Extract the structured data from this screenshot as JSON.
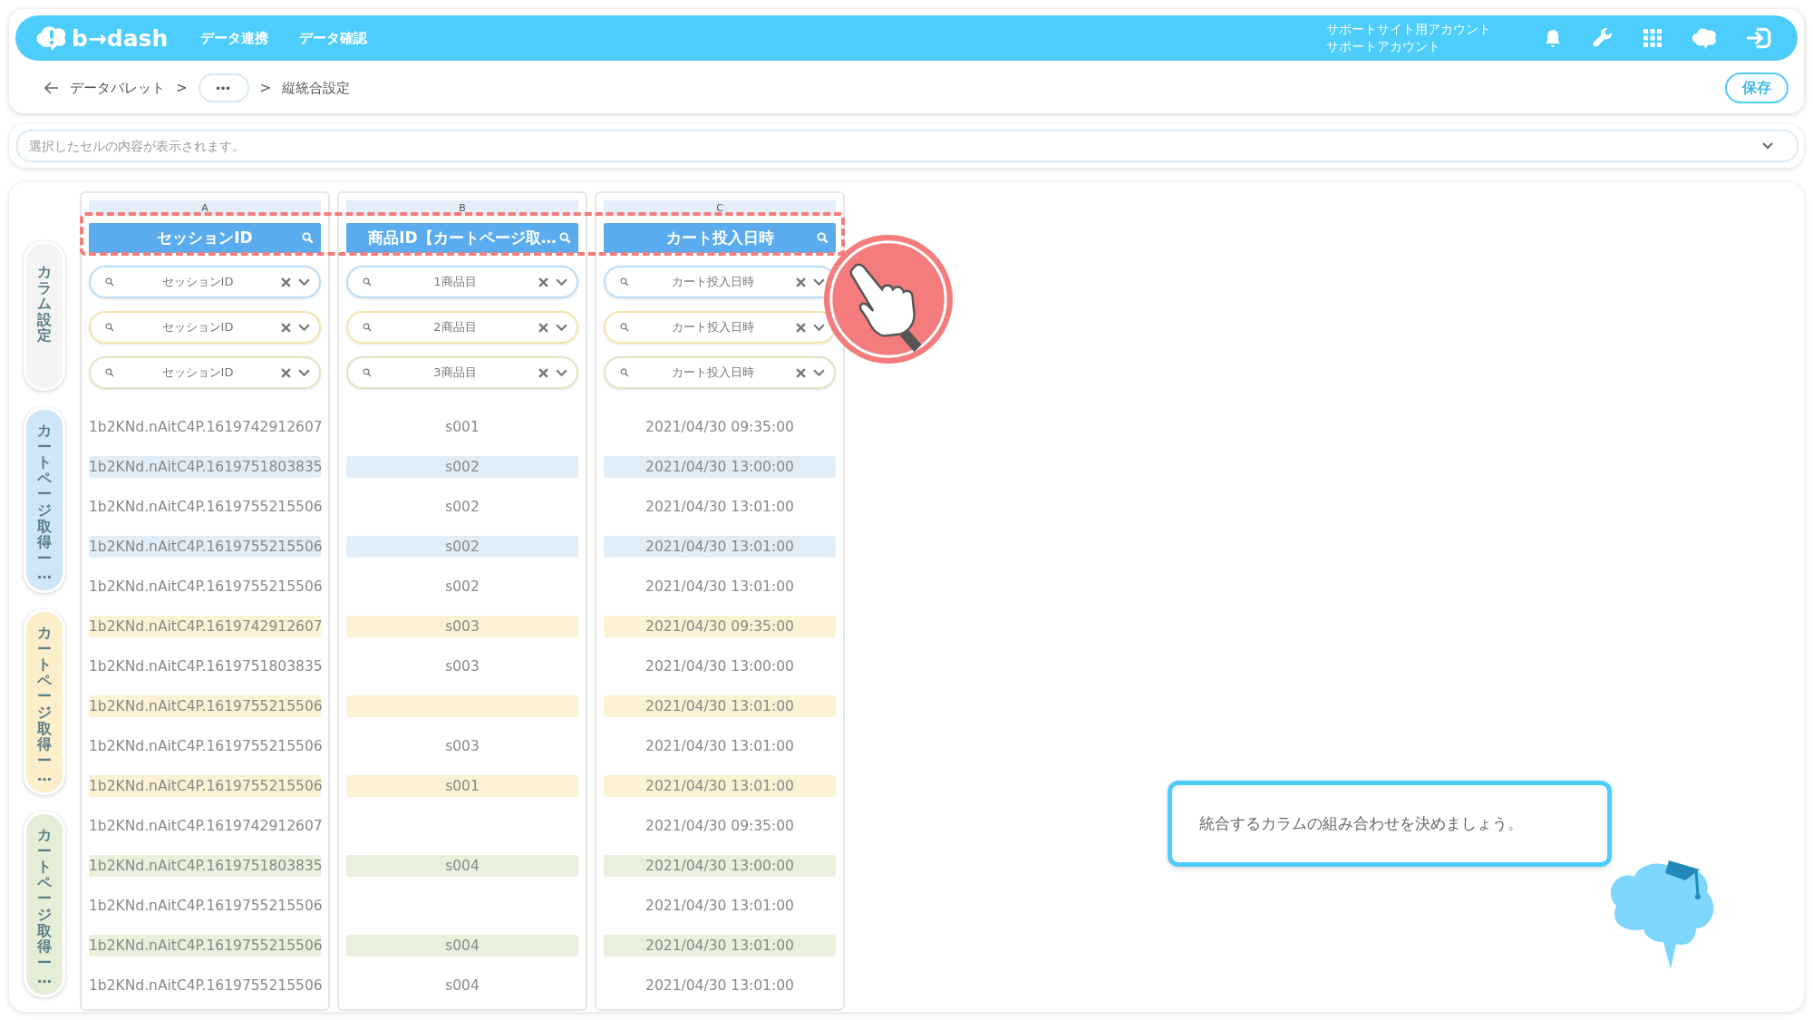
{
  "header": {
    "logo_text": "b→dash",
    "nav": [
      "データ連携",
      "データ確認"
    ],
    "account": [
      "サポートサイト用アカウント",
      "サポートアカウント"
    ]
  },
  "breadcrumb": {
    "items": [
      "データパレット",
      ">",
      "•••",
      ">",
      "縦統合設定"
    ],
    "save": "保存"
  },
  "cell_bar": {
    "placeholder": "選択したセルの内容が表示されます。"
  },
  "side_tabs": [
    {
      "label": "カラム設定"
    },
    {
      "label": "カートページ取得ー…",
      "color": "#cfe6fa"
    },
    {
      "label": "カートページ取得ー…",
      "color": "#fbeec8"
    },
    {
      "label": "カートページ取得ー…",
      "color": "#e4edd6"
    }
  ],
  "columns": [
    {
      "letter": "A",
      "title": "セッションID"
    },
    {
      "letter": "B",
      "title": "商品ID【カートページ取…"
    },
    {
      "letter": "C",
      "title": "カート投入日時"
    }
  ],
  "filter_rows": [
    {
      "color": "#bcdcf5",
      "values": [
        "セッションID",
        "1商品目",
        "カート投入日時"
      ]
    },
    {
      "color": "#f5e4ad",
      "values": [
        "セッションID",
        "2商品目",
        "カート投入日時"
      ]
    },
    {
      "color": "#dbe6c2",
      "values": [
        "セッションID",
        "3商品目",
        "カート投入日時"
      ]
    }
  ],
  "rows": [
    {
      "cells": [
        "1b2KNd.nAitC4P.1619742912607",
        "s001",
        "2021/04/30 09:35:00"
      ]
    },
    {
      "color": "#e1eef8",
      "cells": [
        "1b2KNd.nAitC4P.1619751803835",
        "s002",
        "2021/04/30 13:00:00"
      ]
    },
    {
      "cells": [
        "1b2KNd.nAitC4P.1619755215506",
        "s002",
        "2021/04/30 13:01:00"
      ]
    },
    {
      "color": "#e1eef8",
      "cells": [
        "1b2KNd.nAitC4P.1619755215506",
        "s002",
        "2021/04/30 13:01:00"
      ]
    },
    {
      "cells": [
        "1b2KNd.nAitC4P.1619755215506",
        "s002",
        "2021/04/30 13:01:00"
      ]
    },
    {
      "color": "#fbf1d3",
      "cells": [
        "1b2KNd.nAitC4P.1619742912607",
        "s003",
        "2021/04/30 09:35:00"
      ]
    },
    {
      "cells": [
        "1b2KNd.nAitC4P.1619751803835",
        "s003",
        "2021/04/30 13:00:00"
      ]
    },
    {
      "color": "#fbf1d3",
      "cells": [
        "1b2KNd.nAitC4P.1619755215506",
        null,
        "2021/04/30 13:01:00"
      ]
    },
    {
      "cells": [
        "1b2KNd.nAitC4P.1619755215506",
        "s003",
        "2021/04/30 13:01:00"
      ]
    },
    {
      "color": "#fbf1d3",
      "cells": [
        "1b2KNd.nAitC4P.1619755215506",
        "s001",
        "2021/04/30 13:01:00"
      ]
    },
    {
      "cells": [
        "1b2KNd.nAitC4P.1619742912607",
        null,
        "2021/04/30 09:35:00"
      ]
    },
    {
      "color": "#e9f0dc",
      "cells": [
        "1b2KNd.nAitC4P.1619751803835",
        "s004",
        "2021/04/30 13:00:00"
      ]
    },
    {
      "cells": [
        "1b2KNd.nAitC4P.1619755215506",
        null,
        "2021/04/30 13:01:00"
      ]
    },
    {
      "color": "#e9f0dc",
      "cells": [
        "1b2KNd.nAitC4P.1619755215506",
        "s004",
        "2021/04/30 13:01:00"
      ]
    },
    {
      "cells": [
        "1b2KNd.nAitC4P.1619755215506",
        "s004",
        "2021/04/30 13:01:00"
      ]
    }
  ],
  "guide": {
    "message": "統合するカラムの組み合わせを決めましょう。"
  }
}
